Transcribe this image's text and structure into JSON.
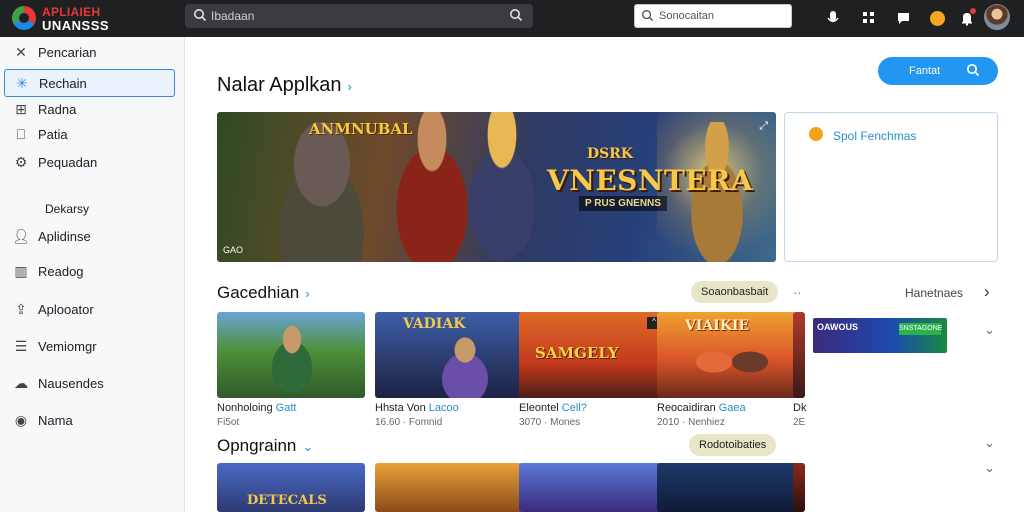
{
  "header": {
    "logo_line1": "APLIAIEH",
    "logo_line2": "UNANSSS",
    "search_left": "Ibadaan",
    "search_right": "Sonocaitan"
  },
  "sidebar": {
    "items": [
      {
        "label": "Pencarian",
        "icon": "close-icon"
      },
      {
        "label": "Rechain",
        "icon": "gear-icon"
      },
      {
        "label": "Radna",
        "icon": "grid-icon"
      },
      {
        "label": "Patia",
        "icon": "bookmark-icon"
      },
      {
        "label": "Pequadan",
        "icon": "gear-icon"
      }
    ],
    "heading": "Dekarsy",
    "items2": [
      {
        "label": "Aplidinse",
        "icon": "user-icon"
      },
      {
        "label": "Readog",
        "icon": "chart-icon"
      },
      {
        "label": "Aplooator",
        "icon": "upload-icon"
      },
      {
        "label": "Vemiomgr",
        "icon": "list-icon"
      },
      {
        "label": "Nausendes",
        "icon": "cloud-icon"
      },
      {
        "label": "Nama",
        "icon": "record-icon"
      }
    ]
  },
  "main": {
    "title": "Nalar Applkan",
    "primary_button": "Fantat",
    "hero": {
      "badge": "ANMNUBAL",
      "superscript": "DSRK",
      "title": "VNESNTERA",
      "subtitle": "P RUS GNENNS",
      "corner": "GAO"
    },
    "side_card_text": "Spol Fenchmas",
    "section1": {
      "title": "Gacedhian",
      "pill": "Soaonbasbait",
      "right_label": "Hanetnaes",
      "cards": [
        {
          "title": "Nonholoing",
          "tag": "Gatt",
          "meta": "Fi5ot"
        },
        {
          "title": "Hhsta Von",
          "tag": "Lacoo",
          "meta": "16.60 · Fomnid"
        },
        {
          "title": "Eleontel",
          "tag": "Cell?",
          "meta": "3070 · Mones"
        },
        {
          "title": "Reocaidiran",
          "tag": "Gaea",
          "meta": "2010 · Nenhiez"
        },
        {
          "title": "Dk",
          "tag": "",
          "meta": "2E"
        }
      ]
    },
    "section2": {
      "title": "Opngrainn",
      "pill": "Rodotoibaties"
    },
    "ad_text": "OAWOUS",
    "ad_label": "SNSTAGONE"
  },
  "colors": {
    "accent": "#2196f3",
    "topbar": "#1f2022",
    "pill": "#e9e5c7",
    "link": "#2a8ccc"
  }
}
